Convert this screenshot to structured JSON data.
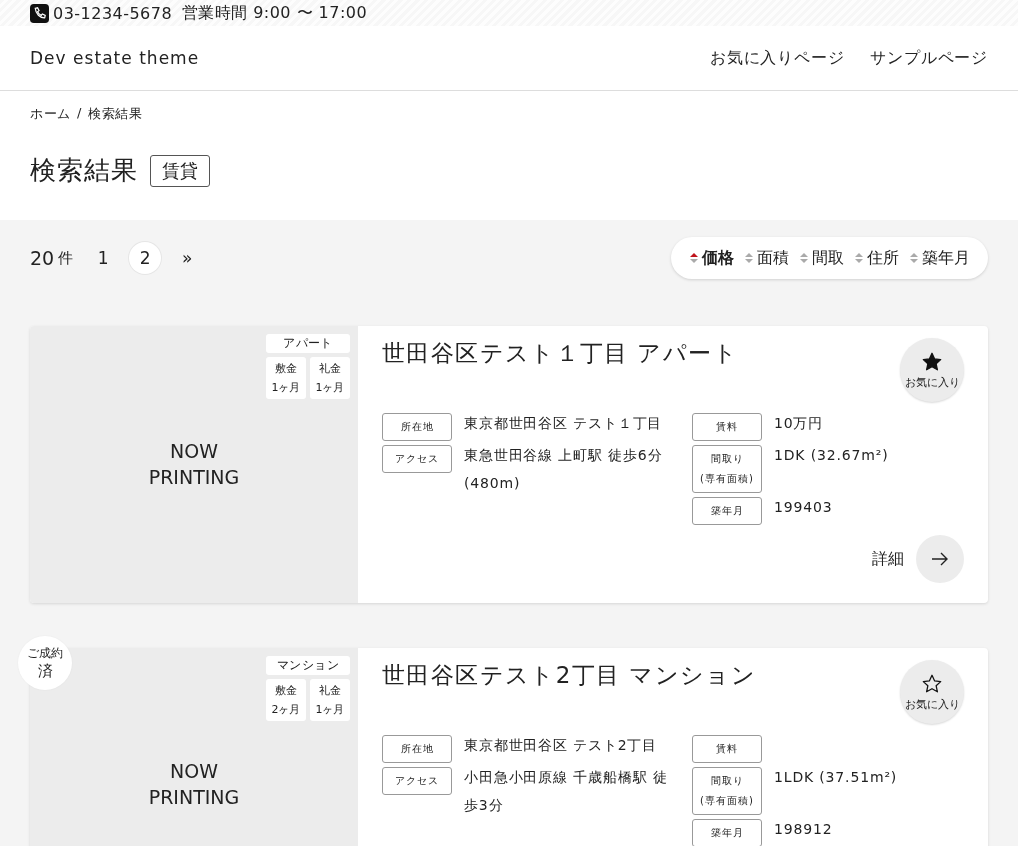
{
  "top_bar": {
    "phone": "03-1234-5678",
    "hours": "営業時間 9:00 〜 17:00"
  },
  "header": {
    "site_title": "Dev estate theme",
    "nav": [
      "お気に入りページ",
      "サンプルページ"
    ]
  },
  "breadcrumb": {
    "items": [
      "ホーム",
      "検索結果"
    ],
    "separator": "/"
  },
  "page_title": "検索結果",
  "category_badge": "賃貸",
  "results": {
    "count": "20",
    "count_unit": "件",
    "pages": [
      {
        "label": "1",
        "selected": false
      },
      {
        "label": "2",
        "selected": true
      }
    ],
    "next": "»"
  },
  "sort": [
    {
      "label": "価格",
      "selected": true
    },
    {
      "label": "面積",
      "selected": false
    },
    {
      "label": "間取",
      "selected": false
    },
    {
      "label": "住所",
      "selected": false
    },
    {
      "label": "築年月",
      "selected": false
    }
  ],
  "properties": [
    {
      "image_text": "NOW PRINTING",
      "type": "アパート",
      "deposit": {
        "label": "敷金",
        "value": "1ヶ月"
      },
      "key_money": {
        "label": "礼金",
        "value": "1ヶ月"
      },
      "title": "世田谷区テスト１丁目 アパート",
      "favorited": true,
      "favorite_label": "お気に入り",
      "details_left": [
        {
          "label": "所在地",
          "value": "東京都世田谷区 テスト１丁目"
        },
        {
          "label": "アクセス",
          "value": "東急世田谷線 上町駅 徒歩6分 (480m)"
        }
      ],
      "details_right": [
        {
          "label": "賃料",
          "value": "10万円"
        },
        {
          "label": "間取り\n(専有面積)",
          "value": "1DK (32.67m²)"
        },
        {
          "label": "築年月",
          "value": "199403"
        }
      ],
      "detail_label": "詳細"
    },
    {
      "sold_badge": {
        "top": "ご成約",
        "main": "済"
      },
      "image_text": "NOW PRINTING",
      "type": "マンション",
      "deposit": {
        "label": "敷金",
        "value": "2ヶ月"
      },
      "key_money": {
        "label": "礼金",
        "value": "1ヶ月"
      },
      "title": "世田谷区テスト2丁目 マンション",
      "favorited": false,
      "favorite_label": "お気に入り",
      "details_left": [
        {
          "label": "所在地",
          "value": "東京都世田谷区 テスト2丁目"
        },
        {
          "label": "アクセス",
          "value": "小田急小田原線 千歳船橋駅 徒歩3分"
        }
      ],
      "details_right": [
        {
          "label": "賃料"
        },
        {
          "label": "間取り\n(専有面積)",
          "value": "1LDK (37.51m²)"
        },
        {
          "label": "築年月",
          "value": "198912"
        }
      ]
    }
  ]
}
